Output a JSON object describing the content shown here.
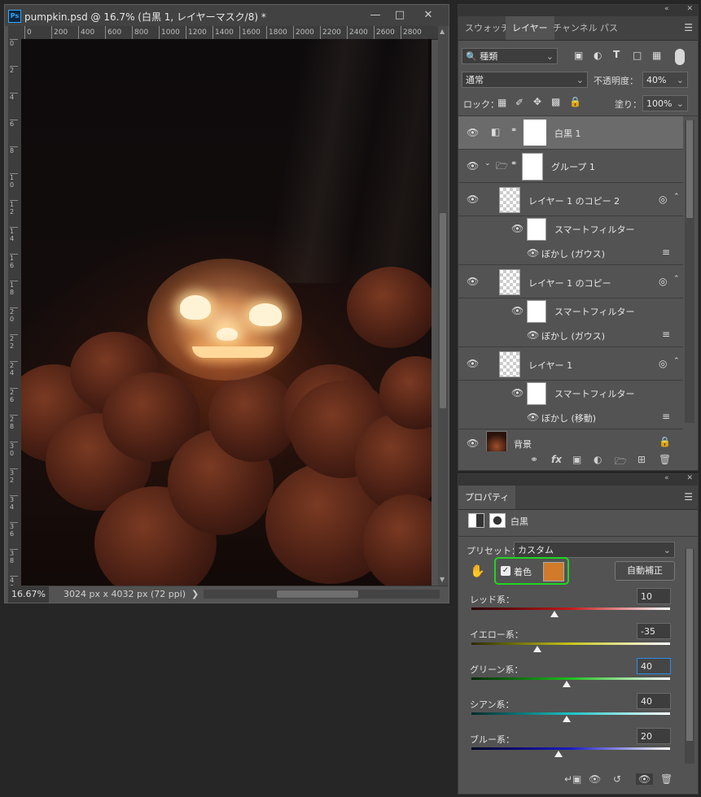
{
  "document": {
    "app_badge": "Ps",
    "title": "pumpkin.psd @ 16.7% (白黒 1, レイヤーマスク/8) *",
    "window_buttons": [
      "minimize",
      "maximize",
      "close"
    ],
    "ruler_top_ticks": [
      "0",
      "200",
      "400",
      "600",
      "800",
      "1000",
      "1200",
      "1400",
      "1600",
      "1800",
      "2000",
      "2200",
      "2400",
      "2600",
      "2800"
    ],
    "ruler_left_ticks": [
      "0",
      "2",
      "4",
      "6",
      "8",
      "1 0",
      "1 2",
      "1 4",
      "1 6",
      "1 8",
      "2 0",
      "2 2",
      "2 4",
      "2 6",
      "2 8",
      "3 0",
      "3 2",
      "3 4",
      "3 6",
      "3 8",
      "4 0"
    ],
    "zoom": "16.67%",
    "doc_info": "3024 px x 4032 px (72 ppi)"
  },
  "layers_panel": {
    "collapse": "«",
    "tabs": [
      {
        "label": "スウォッチ",
        "active": false
      },
      {
        "label": "レイヤー",
        "active": true
      },
      {
        "label": "チャンネル",
        "active": false
      },
      {
        "label": "パス",
        "active": false
      }
    ],
    "filter_kind": "種類",
    "blend_mode": "通常",
    "opacity_label": "不透明度：",
    "opacity_value": "40%",
    "lock_label": "ロック：",
    "fill_label": "塗り：",
    "fill_value": "100%",
    "layers": [
      {
        "name": "白黒 1",
        "selected": true
      },
      {
        "name": "グループ 1"
      },
      {
        "name": "レイヤー 1 のコピー 2"
      },
      {
        "name": "スマートフィルター"
      },
      {
        "name": "ぼかし (ガウス)"
      },
      {
        "name": "レイヤー 1 のコピー"
      },
      {
        "name": "スマートフィルター"
      },
      {
        "name": "ぼかし (ガウス)"
      },
      {
        "name": "レイヤー 1"
      },
      {
        "name": "スマートフィルター"
      },
      {
        "name": "ぼかし (移動)"
      },
      {
        "name": "背景"
      }
    ]
  },
  "properties_panel": {
    "collapse": "«",
    "tab_label": "プロパティ",
    "adjustment_name": "白黒",
    "preset_label": "プリセット：",
    "preset_value": "カスタム",
    "tint_label": "着色",
    "tint_checked": true,
    "tint_color": "#d07a2a",
    "highlight_color": "#22d322",
    "auto_button": "自動補正",
    "sliders": [
      {
        "label": "レッド系：",
        "value": "10",
        "level": 10,
        "gradient": [
          "#2a0000",
          "#c41a1a",
          "#ffffff"
        ]
      },
      {
        "label": "イエロー系：",
        "value": "-35",
        "level": -35,
        "gradient": [
          "#2a2a00",
          "#c7c51a",
          "#ffffff"
        ]
      },
      {
        "label": "グリーン系：",
        "value": "40",
        "level": 40,
        "gradient": [
          "#002a00",
          "#1fbf1f",
          "#ffffff"
        ],
        "focused": true
      },
      {
        "label": "シアン系：",
        "value": "40",
        "level": 40,
        "gradient": [
          "#002a2a",
          "#1ac4c4",
          "#ffffff"
        ]
      },
      {
        "label": "ブルー系：",
        "value": "20",
        "level": 20,
        "gradient": [
          "#00002a",
          "#1a1ac4",
          "#ffffff"
        ]
      }
    ],
    "slider_range": [
      -200,
      300
    ]
  }
}
